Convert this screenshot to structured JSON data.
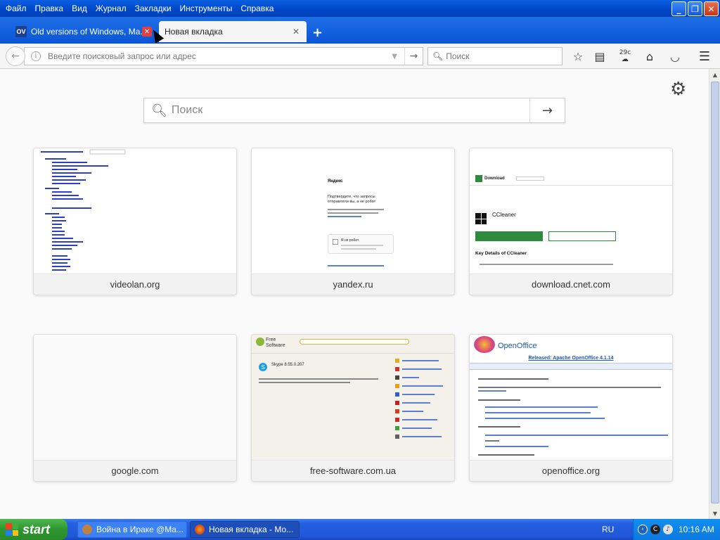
{
  "menubar": {
    "items": [
      "Файл",
      "Правка",
      "Вид",
      "Журнал",
      "Закладки",
      "Инструменты",
      "Справка"
    ]
  },
  "window_controls": {
    "minimize": "_",
    "restore": "❐",
    "close": "✕"
  },
  "tabs": [
    {
      "favicon": "OV",
      "title": "Old versions of Windows, Ma...",
      "active": false
    },
    {
      "title": "Новая вкладка",
      "active": true
    }
  ],
  "newtab_label": "+",
  "toolbar": {
    "url_placeholder": "Введите поисковый запрос или адрес",
    "search_placeholder": "Поиск",
    "weather": "29c"
  },
  "newtab_page": {
    "search_placeholder": "Поиск",
    "tiles": [
      {
        "label": "videolan.org"
      },
      {
        "label": "yandex.ru",
        "brand": "Яндекс",
        "text": "Подтвердите, что запросы отправляли вы, а не робот",
        "captcha": "Я не робот"
      },
      {
        "label": "download.cnet.com",
        "header": "Download",
        "product": "CCleaner",
        "section": "Key Details of CCleaner"
      },
      {
        "label": "google.com"
      },
      {
        "label": "free-software.com.ua",
        "brand": "Free Software",
        "product": "Skype 8.55.0.207"
      },
      {
        "label": "openoffice.org",
        "brand": "OpenOffice",
        "headline": "Released: Apache OpenOffice 4.1.14"
      }
    ]
  },
  "taskbar": {
    "start_label": "start",
    "items": [
      {
        "title": "Война в Ираке @Ma..."
      },
      {
        "title": "Новая вкладка - Мо..."
      }
    ],
    "language": "RU",
    "clock": "10:16 AM"
  },
  "colors": {
    "xp_blue": "#0a5fe0",
    "start_green": "#2e962e",
    "tray_blue": "#0c78e0"
  }
}
